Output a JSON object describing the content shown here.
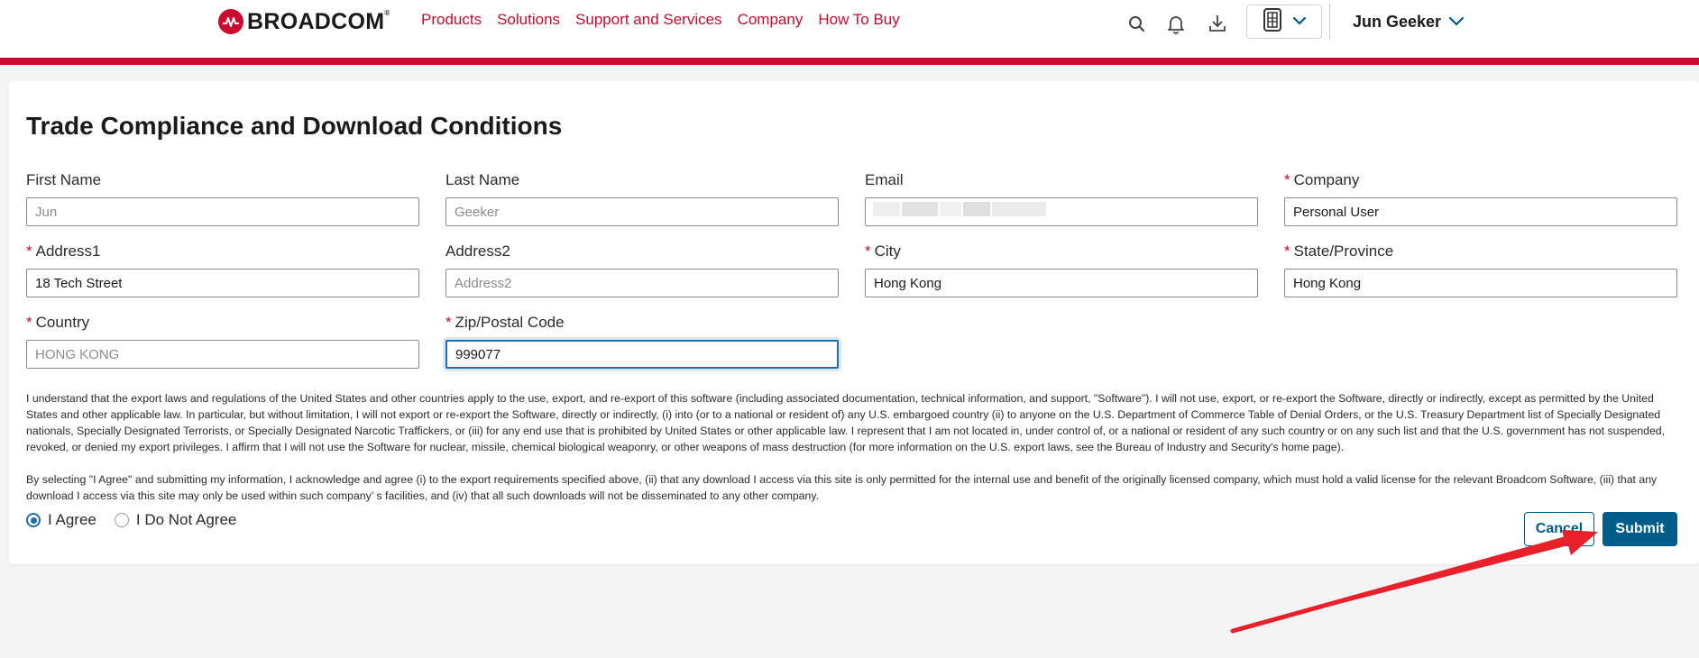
{
  "header": {
    "logo_text": "BROADCOM",
    "nav": [
      "Products",
      "Solutions",
      "Support and Services",
      "Company",
      "How To Buy"
    ],
    "user_name": "Jun Geeker",
    "icons": [
      "search-icon",
      "bell-icon",
      "download-icon",
      "vault-icon",
      "chevron-down-icon"
    ]
  },
  "page": {
    "title": "Trade Compliance and Download Conditions"
  },
  "form": {
    "first_name": {
      "label": "First Name",
      "placeholder": "Jun"
    },
    "last_name": {
      "label": "Last Name",
      "placeholder": "Geeker"
    },
    "email": {
      "label": "Email"
    },
    "company": {
      "label": "Company",
      "value": "Personal User"
    },
    "address1": {
      "label": "Address1",
      "value": "18 Tech Street"
    },
    "address2": {
      "label": "Address2",
      "placeholder": "Address2"
    },
    "city": {
      "label": "City",
      "value": "Hong Kong"
    },
    "state": {
      "label": "State/Province",
      "value": "Hong Kong"
    },
    "country": {
      "label": "Country",
      "value": "HONG KONG"
    },
    "zip": {
      "label": "Zip/Postal Code",
      "value": "999077"
    }
  },
  "legal": {
    "paragraph1": "I understand that the export laws and regulations of the United States and other countries apply to the use, export, and re-export of this software (including associated documentation, technical information, and support, \"Software\"). I will not use, export, or re-export the Software, directly or indirectly, except as permitted by the United States and other applicable law. In particular, but without limitation, I will not export or re-export the Software, directly or indirectly, (i) into (or to a national or resident of) any U.S. embargoed country (ii) to anyone on the U.S. Department of Commerce Table of Denial Orders, or the U.S. Treasury Department list of Specially Designated nationals, Specially Designated Terrorists, or Specially Designated Narcotic Traffickers, or (iii) for any end use that is prohibited by United States or other applicable law. I represent that I am not located in, under control of, or a national or resident of any such country or on any such list and that the U.S. government has not suspended, revoked, or denied my export privileges. I affirm that I will not use the Software for nuclear, missile, chemical biological weaponry, or other weapons of mass destruction (for more information on the U.S. export laws, see the Bureau of Industry and Security's home page).",
    "paragraph2": "By selecting \"I Agree\" and submitting my information, I acknowledge and agree (i) to the export requirements specified above, (ii) that any download I access via this site is only permitted for the internal use and benefit of the originally licensed company, which must hold a valid license for the relevant Broadcom Software, (iii) that any download I access via this site may only be used within such company’ s facilities, and (iv) that all such downloads will not be disseminated to any other company."
  },
  "agreement": {
    "agree_label": "I Agree",
    "disagree_label": "I Do Not Agree",
    "selected": "I Agree"
  },
  "buttons": {
    "cancel": "Cancel",
    "submit": "Submit"
  },
  "colors": {
    "brand_red": "#cc092f",
    "primary_blue": "#005c8a",
    "annotation_arrow": "#e8202a"
  }
}
